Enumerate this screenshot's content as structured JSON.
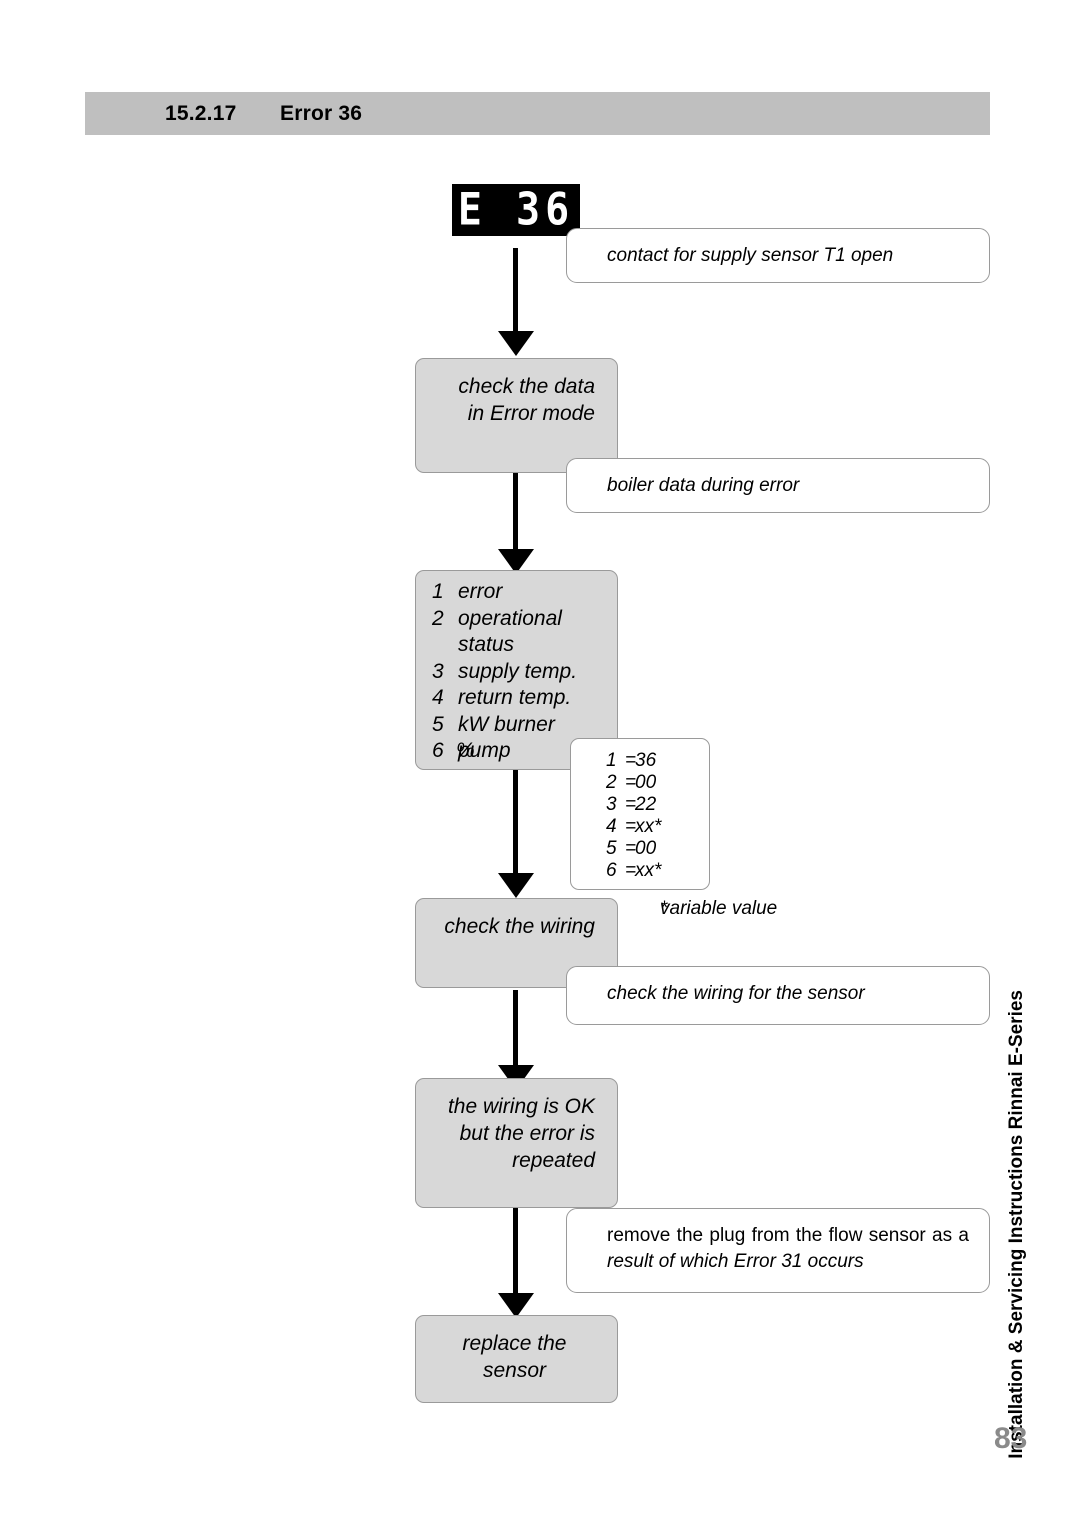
{
  "header": {
    "number": "15.2.17",
    "title": "Error 36"
  },
  "display": {
    "value": "E 36"
  },
  "flow": {
    "box_check_data": "check the data\nin Error mode",
    "box_check_data_line1": "check the data",
    "box_check_data_line2": "in Error mode",
    "box_check_wiring": "check the wiring",
    "box_wiring_ok_line1": "the wiring is OK",
    "box_wiring_ok_line2": "but the error is",
    "box_wiring_ok_line3": "repeated",
    "box_replace_line1": "replace the",
    "box_replace_line2": "sensor"
  },
  "list": {
    "items": [
      {
        "index": "1",
        "label": "error"
      },
      {
        "index": "2",
        "label": "operational"
      },
      {
        "index": "",
        "label": "status"
      },
      {
        "index": "3",
        "label": "supply temp."
      },
      {
        "index": "4",
        "label": "return temp."
      },
      {
        "index": "5",
        "label": "kW burner"
      },
      {
        "index": "6",
        "label": "pump",
        "prefix": "%"
      }
    ]
  },
  "values": {
    "rows": [
      {
        "index": "1",
        "eq": "=",
        "value": "36"
      },
      {
        "index": "2",
        "eq": "=",
        "value": "00"
      },
      {
        "index": "3",
        "eq": "=",
        "value": "22"
      },
      {
        "index": "4",
        "eq": "=",
        "value": "xx*"
      },
      {
        "index": "5",
        "eq": "=",
        "value": "00"
      },
      {
        "index": "6",
        "eq": "=",
        "value": "xx*"
      }
    ],
    "footnote_marker": "*",
    "footnote_text": "variable value"
  },
  "callouts": {
    "contact_sensor": "contact for supply sensor T1 open",
    "boiler_data": "boiler data during error",
    "wiring_sensor": "check the wiring for the sensor",
    "remove_plug_line1": "remove the plug from the flow sensor as a",
    "remove_plug_line2": "result of which Error 31 occurs"
  },
  "footer": {
    "side_text": "Installation & Servicing Instructions Rinnai E-Series",
    "page_number": "83"
  },
  "colors": {
    "header_band": "#bfbfbf",
    "process_box": "#d8d8d8",
    "box_border": "#9a9a9a",
    "display_bg": "#000000",
    "display_fg": "#ffffff",
    "page_number": "#8a8a8a"
  }
}
